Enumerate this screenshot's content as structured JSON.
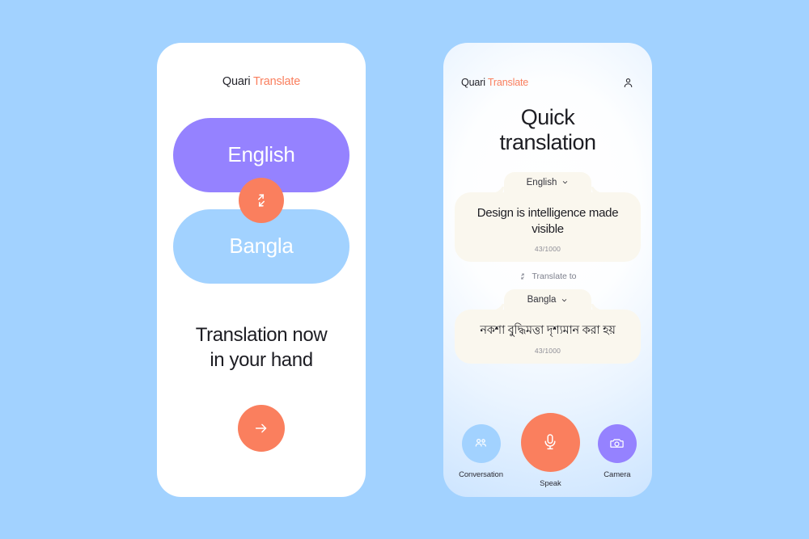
{
  "theme": {
    "page_background": "#a2d2ff",
    "accent_orange": "#fa7f5e",
    "accent_purple": "#9582ff",
    "accent_blue": "#a2d2ff",
    "card_cream": "#faf7ee",
    "text_dark": "#1d1d23"
  },
  "brand": {
    "name_first": "Quari",
    "name_second": "Translate"
  },
  "screen_one": {
    "source_language": "English",
    "target_language": "Bangla",
    "swap_icon": "swap-vertical-arrows-icon",
    "tagline_line_1": "Translation now",
    "tagline_line_2": "in your hand",
    "cta_icon": "arrow-right-icon"
  },
  "screen_two": {
    "account_icon": "person-icon",
    "title_line_1": "Quick",
    "title_line_2": "translation",
    "source": {
      "language": "English",
      "chevron_icon": "chevron-down-icon",
      "text": "Design is intelligence made visible",
      "char_count": "43/1000"
    },
    "divider": {
      "icon": "swap-small-icon",
      "label": "Translate to"
    },
    "target": {
      "language": "Bangla",
      "chevron_icon": "chevron-down-icon",
      "text": "নকশা বুদ্ধিমত্তা দৃশ্যমান করা হয়",
      "char_count": "43/1000"
    },
    "actions": [
      {
        "label": "Conversation",
        "icon": "people-group-icon",
        "color": "#a2d2ff"
      },
      {
        "label": "Speak",
        "icon": "microphone-icon",
        "color": "#fa7f5e"
      },
      {
        "label": "Camera",
        "icon": "camera-icon",
        "color": "#9582ff"
      }
    ]
  }
}
